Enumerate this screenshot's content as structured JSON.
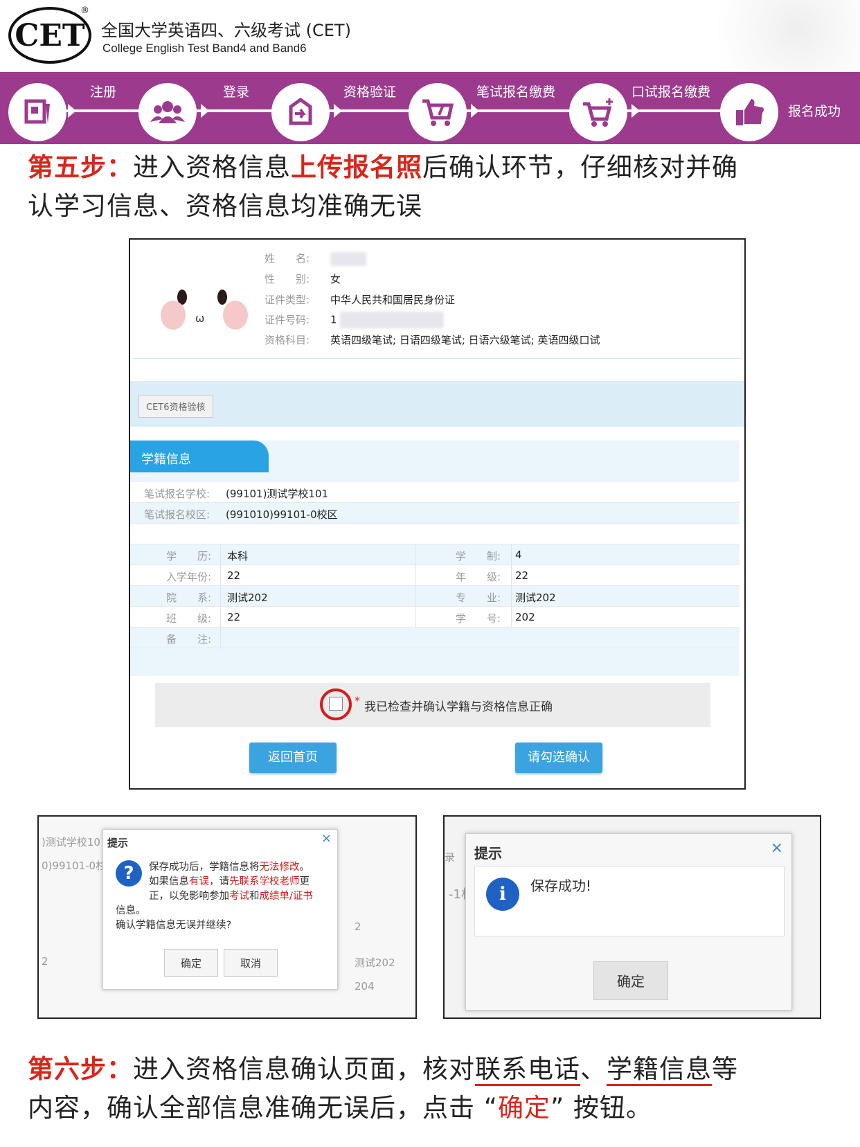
{
  "header": {
    "logo_text": "CET",
    "reg_mark": "®",
    "title_cn": "全国大学英语四、六级考试 (CET)",
    "title_en": "College English Test Band4 and Band6"
  },
  "steps": [
    {
      "label": "注册",
      "icon": "register-icon"
    },
    {
      "label": "登录",
      "icon": "users-icon"
    },
    {
      "label": "资格验证",
      "icon": "verify-icon"
    },
    {
      "label": "笔试报名缴费",
      "icon": "cart-icon"
    },
    {
      "label": "口试报名缴费",
      "icon": "cart-plus-icon"
    },
    {
      "label": "报名成功",
      "icon": "thumbs-up-icon"
    }
  ],
  "step5": {
    "prefix": "第五步：",
    "part1": "进入资格信息",
    "highlight": "上传报名照",
    "part2": "后确认环节，仔细核对并确",
    "line2": "认学习信息、资格信息均准确无误"
  },
  "profile": {
    "name_label": "姓　　名:",
    "gender_label": "性　　别:",
    "gender": "女",
    "idtype_label": "证件类型:",
    "idtype": "中华人民共和国居民身份证",
    "idno_label": "证件号码:",
    "idno": "1",
    "subjects_label": "资格科目:",
    "subjects": "英语四级笔试; 日语四级笔试; 日语六级笔试; 英语四级口试",
    "mouth": "ω"
  },
  "cert_tab": "CET6资格验核",
  "xueji": {
    "title": "学籍信息",
    "school_label": "笔试报名学校:",
    "school": "(99101)测试学校101",
    "campus_label": "笔试报名校区:",
    "campus": "(991010)99101-0校区",
    "edu_label": "学　　历:",
    "edu": "本科",
    "length_label": "学　　制:",
    "length": "4",
    "year_label": "入学年份:",
    "year": "22",
    "grade_label": "年　　级:",
    "grade": "22",
    "dept_label": "院　　系:",
    "dept": "测试202",
    "major_label": "专　　业:",
    "major": "测试202",
    "class_label": "班　　级:",
    "class": "22",
    "sid_label": "学　　号:",
    "sid": "202",
    "note_label": "备　　注:"
  },
  "confirm": {
    "star": "*",
    "text": "我已检查并确认学籍与资格信息正确",
    "back_button": "返回首页",
    "confirm_button": "请勾选确认"
  },
  "dialog1": {
    "bg_school": ")测试学校10",
    "bg_campus": "0)99101-0杉",
    "bg_two": "2",
    "bg_2": "2",
    "bg_test": "测试202",
    "bg_204": "204",
    "title": "提示",
    "close": "×",
    "icon": "?",
    "m1a": "保存成功后，学籍信息将",
    "m1b": "无法修改",
    "m1c": "。",
    "m2a": "如果信息",
    "m2b": "有误",
    "m2c": "，请",
    "m2d": "先联系学校老师",
    "m2e": "更",
    "m3a": "正，以免影响参加",
    "m3b": "考试",
    "m3c": "和",
    "m3d": "成绩单/证书",
    "m4": "信息。",
    "m5": "确认学籍信息无误并继续?",
    "ok": "确定",
    "cancel": "取消"
  },
  "dialog2": {
    "bg_a": "录",
    "bg_b": "-1杉",
    "title": "提示",
    "close": "×",
    "icon": "i",
    "message": "保存成功!",
    "ok": "确定"
  },
  "step6": {
    "prefix": "第六步：",
    "part1": "进入资格信息确认页面，核对",
    "u1": "联系电话",
    "sep": "、",
    "u2": "学籍信息",
    "part2": "等",
    "line2a": "内容，确认全部信息准确无误后，点击 “",
    "line2b": "确定",
    "line2c": "” 按钮。"
  },
  "colors": {
    "brand_purple": "#9c3b8e",
    "accent_red": "#d8261b",
    "button_blue": "#3aa3e0"
  }
}
